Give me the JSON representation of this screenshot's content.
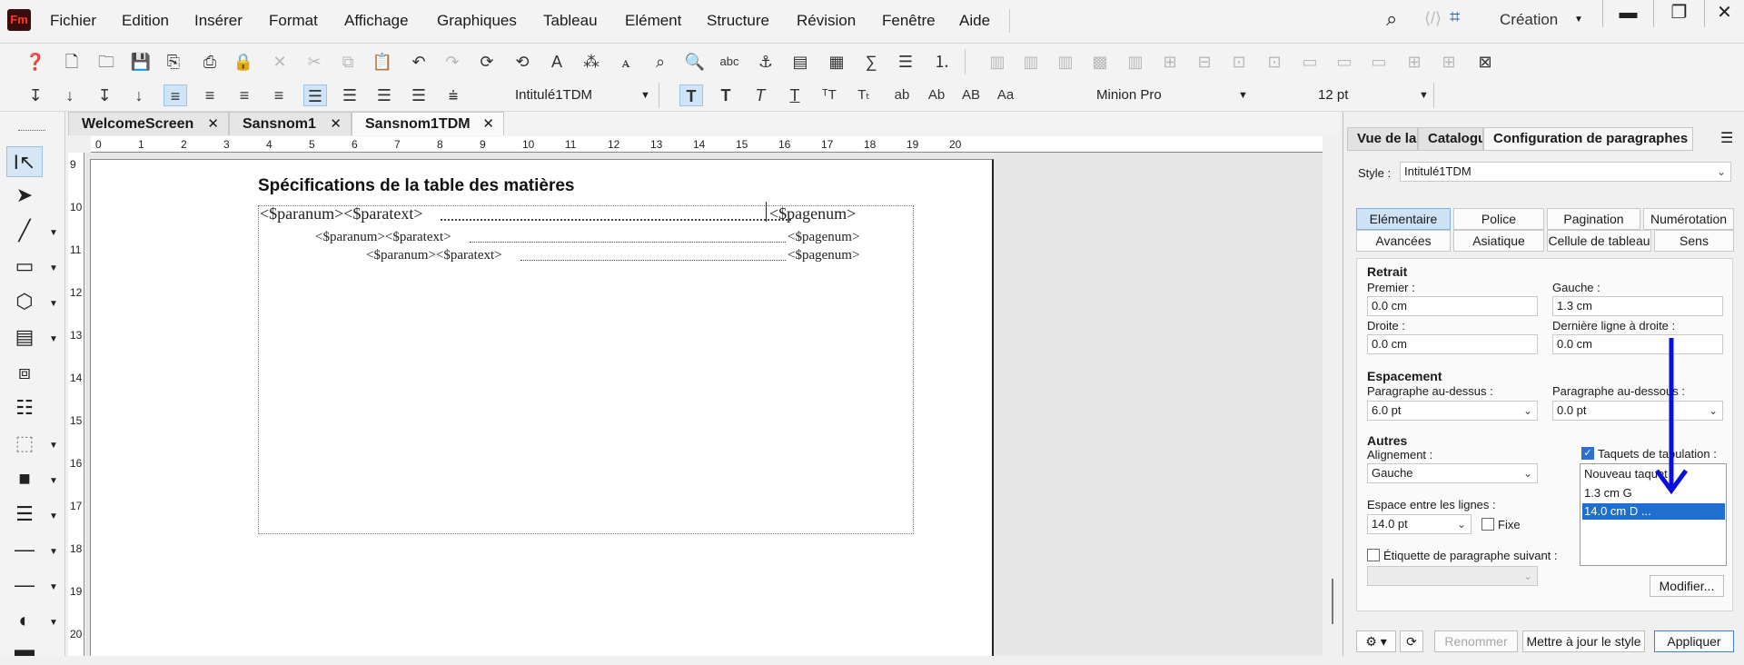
{
  "menubar": {
    "logo": "Fm",
    "items": [
      "Fichier",
      "Edition",
      "Insérer",
      "Format",
      "Affichage",
      "Graphiques",
      "Tableau",
      "Elément",
      "Structure",
      "Révision",
      "Fenêtre",
      "Aide"
    ],
    "workspace": "Création"
  },
  "format_toolbar": {
    "paragraph_style": "Intitulé1TDM",
    "font_family": "Minion Pro",
    "font_size": "12 pt",
    "text_buttons": [
      "ab",
      "Ab",
      "AB",
      "Aa"
    ]
  },
  "tabs": [
    {
      "label": "WelcomeScreen"
    },
    {
      "label": "Sansnom1"
    },
    {
      "label": "Sansnom1TDM"
    }
  ],
  "ruler": {
    "h_numbers": [
      "0",
      "1",
      "2",
      "3",
      "4",
      "5",
      "6",
      "7",
      "8",
      "9",
      "10",
      "11",
      "12",
      "13",
      "14",
      "15",
      "16",
      "17",
      "18",
      "19",
      "20"
    ],
    "v_numbers": [
      "9",
      "10",
      "11",
      "12",
      "13",
      "14",
      "15",
      "16",
      "17",
      "18",
      "19",
      "20"
    ]
  },
  "document": {
    "title": "Spécifications de la table des matières",
    "lines": [
      {
        "left": "<$paranum><$paratext>",
        "right": "<$pagenum>"
      },
      {
        "left": "<$paranum><$paratext>",
        "right": "<$pagenum>"
      },
      {
        "left": "<$paranum><$paratext>",
        "right": "<$pagenum>"
      }
    ]
  },
  "panel": {
    "tabs": [
      "Vue de la",
      "Catalogu",
      "Configuration de paragraphes"
    ],
    "style_label": "Style :",
    "style_value": "Intitulé1TDM",
    "categories": [
      "Elémentaire",
      "Police",
      "Pagination",
      "Numérotation",
      "Avancées",
      "Asiatique",
      "Cellule de tableau",
      "Sens"
    ],
    "retrait": {
      "heading": "Retrait",
      "premier_label": "Premier :",
      "premier_value": "0.0 cm",
      "gauche_label": "Gauche :",
      "gauche_value": "1.3 cm",
      "droite_label": "Droite :",
      "droite_value": "0.0 cm",
      "derniere_label": "Dernière ligne à droite :",
      "derniere_value": "0.0 cm"
    },
    "espacement": {
      "heading": "Espacement",
      "above_label": "Paragraphe au-dessus :",
      "above_value": "6.0 pt",
      "below_label": "Paragraphe au-dessous :",
      "below_value": "0.0 pt"
    },
    "autres": {
      "heading": "Autres",
      "alignement_label": "Alignement :",
      "alignement_value": "Gauche",
      "line_spacing_label": "Espace entre les lignes :",
      "line_spacing_value": "14.0 pt",
      "fixe_label": "Fixe",
      "next_para_label": "Étiquette de paragraphe suivant :",
      "tab_stops_label": "Taquets de tabulation :",
      "tab_stops": [
        "Nouveau taquet",
        "1.3 cm  G",
        "14.0 cm  D ..."
      ],
      "modify_button": "Modifier..."
    },
    "footer": {
      "rename": "Renommer",
      "update_style": "Mettre à jour le style",
      "apply": "Appliquer"
    }
  },
  "annotation": {
    "arrow_color": "#0a10d8"
  }
}
